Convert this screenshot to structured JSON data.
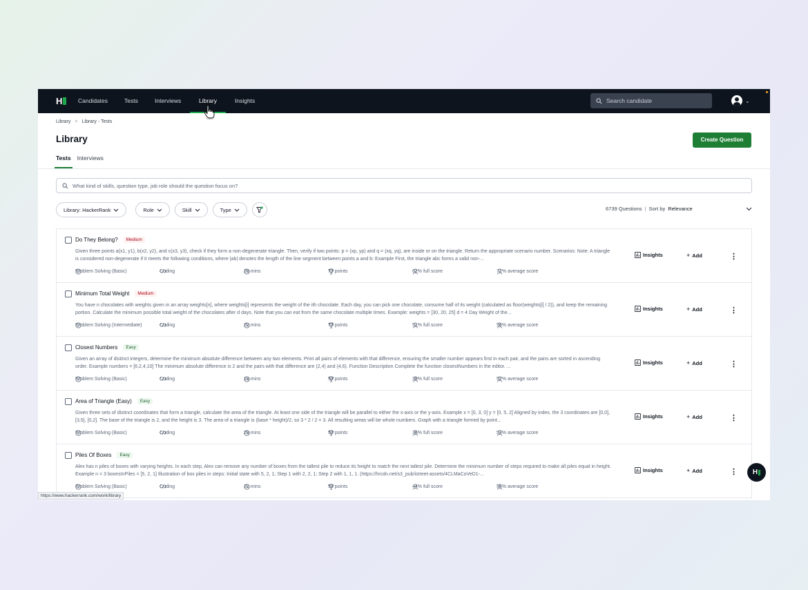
{
  "nav": {
    "items": [
      "Candidates",
      "Tests",
      "Interviews",
      "Library",
      "Insights"
    ],
    "active": "Library",
    "search_placeholder": "Search candidate"
  },
  "breadcrumb": [
    "Library",
    "Library - Tests"
  ],
  "page": {
    "title": "Library",
    "create_button": "Create Question",
    "tabs": [
      "Tests",
      "Interviews"
    ]
  },
  "question_search": {
    "placeholder": "What kind of skills, question type, job role should the question focus on?"
  },
  "filters": {
    "library": "Library: HackerRank",
    "role": "Role",
    "skill": "Skill",
    "type": "Type"
  },
  "sort": {
    "count": "6739 Questions",
    "label": "Sort by",
    "value": "Relevance"
  },
  "actions": {
    "insights": "Insights",
    "add": "Add"
  },
  "questions": [
    {
      "title": "Do They Belong?",
      "difficulty": "Medium",
      "description": "Given three points a(x1, y1), b(x2, y2), and c(x3, y3), check if they form a non-degenerate triangle. Then, verify if two points: p = (xp, yp) and q = (xq, yq), are inside or on the triangle. Return the appropriate scenario number. Scenarios:    Note: A triangle is considered non-degenerate if it meets the following conditions, where |ab| denotes the length of the line segment between points a and b:    Example    First, the triangle abc forms a valid non-...",
      "skill": "Problem Solving (Basic)",
      "type": "Coding",
      "time": "28 mins",
      "points": "75 points",
      "full_score": "62% full score",
      "avg_score": "72% average score"
    },
    {
      "title": "Minimum Total Weight",
      "difficulty": "Medium",
      "description": "You have n chocolates with weights given in an array weights[n], where weights[i] represents the weight of the ith chocolate. Each day, you can pick one chocolate, consume half of its weight (calculated as floor(weights[i] / 2)), and keep the remaining portion. Calculate the minimum possible total weight of the chocolates after d days. Note that you can eat from the same chocolate multiple times. Example: weights = [30, 20, 25]  d = 4  Day Weight of the...",
      "skill": "Problem Solving (Intermediate)",
      "type": "Coding",
      "time": "22 mins",
      "points": "75 points",
      "full_score": "51% full score",
      "avg_score": "56% average score"
    },
    {
      "title": "Closest Numbers",
      "difficulty": "Easy",
      "description": "Given an array of distinct integers, determine the minimum absolute difference between any two elements. Print all pairs of elements with that difference, ensuring the smaller number appears first in each pair, and the pairs are sorted in ascending order.   Example numbers = [6,2,4,10] The minimum absolute difference is 2 and the pairs with that difference are (2,4) and (4,6).   Function Description Complete the function closestNumbers in the editor.  ...",
      "skill": "Problem Solving (Basic)",
      "type": "Coding",
      "time": "18 mins",
      "points": "50 points",
      "full_score": "39% full score",
      "avg_score": "52% average score"
    },
    {
      "title": "Area of Triangle (Easy)",
      "difficulty": "Easy",
      "description": "Given three sets of distinct coordinates that form a triangle, calculate the area of the triangle. At least one side of the triangle will be parallel to either the x-axis or the y-axis.   Example x = [0, 3, 0] y = [0, 5, 2]   Aligned by index, the 3 coordinates are [0,0], [3,5], [0,2]. The base of the triangle is 2, and the height is 3. The area of a triangle is (base * height)/2, so 3 * 2 / 2 = 3. All resulting areas will be whole numbers.   Graph with a triangle formed by point...",
      "skill": "Problem Solving (Basic)",
      "type": "Coding",
      "time": "29 mins",
      "points": "50 points",
      "full_score": "36% full score",
      "avg_score": "53% average score"
    },
    {
      "title": "Piles Of Boxes",
      "difficulty": "Easy",
      "description": "Alex has n piles of boxes with varying heights. In each step, Alex can remove any number of boxes from the tallest pile to reduce its height to match the next tallest pile. Determine the minimum number of steps required to make all piles equal in height.   Example n = 3 boxesInPiles = [5, 2, 1]   Illustration of box piles in steps: Initial state with 5, 2, 1; Step 1 with 2, 2, 1; Step 2 with 1, 1, 1. (https://hrcdn.net/s3_pub/istreet-assets/4CLMaCoVeD1-...",
      "skill": "Problem Solving (Basic)",
      "type": "Coding",
      "time": "22 mins",
      "points": "50 points",
      "full_score": "44% full score",
      "avg_score": "56% average score"
    }
  ],
  "status_url": "https://www.hackerrank.com/work/library",
  "colors": {
    "nav_bg": "#0e141e",
    "brand_green": "#1ba94c",
    "button_green": "#1e7e34"
  }
}
